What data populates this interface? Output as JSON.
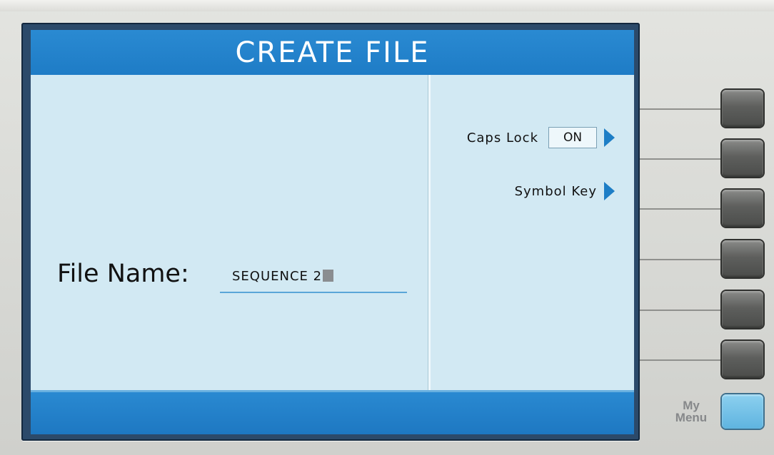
{
  "screen": {
    "title": "CREATE FILE",
    "file_name": {
      "label": "File Name:",
      "value": "SEQUENCE 2"
    },
    "menu": [
      {
        "label": "Caps Lock",
        "value": "ON",
        "icon": "arrow-right-icon"
      },
      {
        "label": "Symbol Key",
        "icon": "arrow-right-icon"
      }
    ]
  },
  "hardware": {
    "soft_key_count": 6,
    "my_menu_label_line1": "My",
    "my_menu_label_line2": "Menu"
  },
  "colors": {
    "title_bar": "#1e7cc6",
    "screen_background": "#d2e9f3",
    "arrow": "#1d7ec6",
    "my_menu_key": "#6cbfe6"
  }
}
